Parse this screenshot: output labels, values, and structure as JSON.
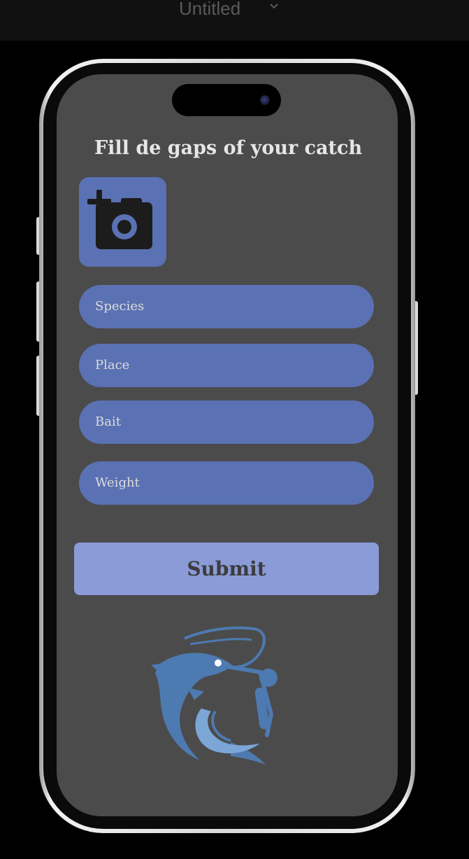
{
  "app": {
    "document_title": "Untitled"
  },
  "form": {
    "heading": "Fill de gaps of your catch",
    "fields": [
      {
        "label": "Species"
      },
      {
        "label": "Place"
      },
      {
        "label": "Bait"
      },
      {
        "label": "Weight"
      }
    ],
    "submit_label": "Submit"
  },
  "icons": {
    "photo": "add-photo-icon",
    "logo": "fish-hook-rod-logo",
    "title_menu": "chevron-down-icon"
  },
  "colors": {
    "screen_background": "#4b4b4b",
    "field": "#5a71b3",
    "submit": "#8a9bd8",
    "heading_text": "#e6e6e6"
  }
}
